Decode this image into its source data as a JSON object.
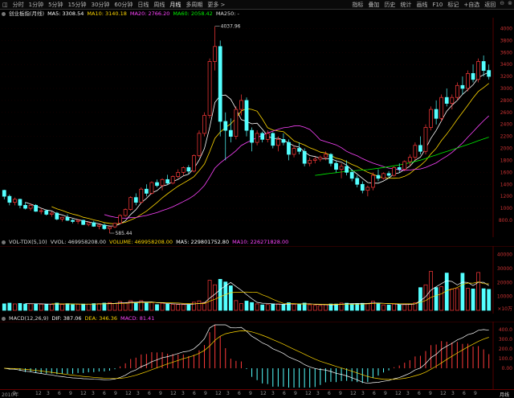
{
  "toolbar": {
    "left_icon": "◫",
    "tabs": [
      "分时",
      "1分钟",
      "5分钟",
      "15分钟",
      "30分钟",
      "60分钟",
      "日线",
      "周线",
      "月线",
      "多周期",
      "更多 >"
    ],
    "active_tab": "月线",
    "right_tabs": [
      "指标",
      "叠加",
      "历史",
      "统计",
      "画线",
      "F10",
      "标记",
      "+自选",
      "返回"
    ],
    "window_icons": [
      "minimize-icon",
      "close-icon"
    ]
  },
  "kline_legend": {
    "title": "创业板指(月线)",
    "ma5": "MA5: 3308.54",
    "ma10": "MA10: 3140.18",
    "ma20": "MA20: 2766.20",
    "ma60": "MA60: 2058.42",
    "ma250": "MA250: -"
  },
  "vol_legend": {
    "title": "VOL-TDX(5,10)",
    "vvol": "VVOL: 469958208.00",
    "volume": "VOLUME: 469958208.00",
    "ma5": "MA5: 229801752.80",
    "ma10": "MA10: 226271828.00"
  },
  "macd_legend": {
    "title": "MACD(12,26,9)",
    "dif": "DIF: 387.06",
    "dea": "DEA: 346.36",
    "macd": "MACD: 81.41"
  },
  "price_axis": [
    "4000",
    "3800",
    "3600",
    "3400",
    "3200",
    "3000",
    "2800",
    "2600",
    "2400",
    "2200",
    "2000",
    "1800",
    "1600",
    "1400",
    "1200",
    "1000",
    "800.0"
  ],
  "price_annotations": {
    "high": "4037.96",
    "low": "585.44"
  },
  "vol_axis": [
    "40000",
    "30000",
    "20000",
    "10000",
    "×10万"
  ],
  "macd_axis": [
    "400.0",
    "300.0",
    "200.0",
    "100.0",
    "0.00"
  ],
  "x_axis": [
    "2010年",
    "9",
    "",
    "12",
    "3",
    "6",
    "9",
    "12",
    "3",
    "6",
    "9",
    "12",
    "3",
    "6",
    "9",
    "12",
    "3",
    "6",
    "9",
    "12",
    "3",
    "6",
    "9",
    "12",
    "3",
    "6",
    "9",
    "12",
    "3",
    "6",
    "9",
    "12",
    "3",
    "6",
    "9",
    "12",
    "3",
    "6",
    "9",
    "12",
    "3",
    "6",
    "9",
    "月线"
  ],
  "colors": {
    "up": "#ff3a3a",
    "down": "#54ffff",
    "ma5": "#ffffff",
    "ma10": "#ffd700",
    "ma20": "#ff44ff",
    "ma60": "#00ee00",
    "grid": "#550000",
    "axis_text": "#cc3333"
  },
  "chart_data": {
    "type": "candlestick",
    "title": "创业板指(月线)",
    "price_ylim": [
      585,
      4100
    ],
    "candles": [
      [
        1300,
        1310,
        1150,
        1200
      ],
      [
        1200,
        1230,
        1050,
        1100
      ],
      [
        1100,
        1180,
        1050,
        1150
      ],
      [
        1150,
        1160,
        1000,
        1050
      ],
      [
        1050,
        1100,
        980,
        1000
      ],
      [
        1000,
        1080,
        960,
        1050
      ],
      [
        1050,
        1070,
        940,
        950
      ],
      [
        950,
        1000,
        900,
        960
      ],
      [
        960,
        980,
        880,
        900
      ],
      [
        900,
        950,
        860,
        920
      ],
      [
        920,
        940,
        800,
        820
      ],
      [
        820,
        860,
        780,
        850
      ],
      [
        850,
        900,
        790,
        800
      ],
      [
        800,
        820,
        750,
        780
      ],
      [
        780,
        820,
        740,
        800
      ],
      [
        800,
        810,
        720,
        730
      ],
      [
        730,
        780,
        700,
        760
      ],
      [
        760,
        790,
        690,
        700
      ],
      [
        700,
        740,
        650,
        720
      ],
      [
        720,
        750,
        640,
        660
      ],
      [
        660,
        700,
        585,
        690
      ],
      [
        690,
        760,
        670,
        750
      ],
      [
        750,
        900,
        740,
        880
      ],
      [
        880,
        1000,
        860,
        980
      ],
      [
        980,
        1200,
        960,
        1180
      ],
      [
        1180,
        1250,
        1050,
        1100
      ],
      [
        1100,
        1350,
        1080,
        1320
      ],
      [
        1320,
        1400,
        1200,
        1250
      ],
      [
        1250,
        1450,
        1230,
        1430
      ],
      [
        1430,
        1480,
        1350,
        1380
      ],
      [
        1380,
        1500,
        1300,
        1480
      ],
      [
        1480,
        1560,
        1400,
        1420
      ],
      [
        1420,
        1550,
        1400,
        1530
      ],
      [
        1530,
        1650,
        1500,
        1600
      ],
      [
        1600,
        1700,
        1550,
        1680
      ],
      [
        1680,
        1720,
        1580,
        1620
      ],
      [
        1620,
        1900,
        1600,
        1880
      ],
      [
        1880,
        2300,
        1850,
        2250
      ],
      [
        2250,
        2600,
        2200,
        2550
      ],
      [
        2550,
        3500,
        2500,
        3450
      ],
      [
        3450,
        4037,
        3300,
        3700
      ],
      [
        3700,
        3800,
        2200,
        2450
      ],
      [
        2450,
        2600,
        1800,
        2300
      ],
      [
        2300,
        2500,
        2100,
        2200
      ],
      [
        2200,
        2700,
        2150,
        2650
      ],
      [
        2650,
        2900,
        2550,
        2800
      ],
      [
        2800,
        2850,
        2200,
        2300
      ],
      [
        2300,
        2350,
        1950,
        2100
      ],
      [
        2100,
        2300,
        2050,
        2250
      ],
      [
        2250,
        2280,
        2100,
        2150
      ],
      [
        2150,
        2300,
        2100,
        2250
      ],
      [
        2250,
        2270,
        2000,
        2050
      ],
      [
        2050,
        2200,
        1950,
        2150
      ],
      [
        2150,
        2250,
        2050,
        2100
      ],
      [
        2100,
        2150,
        1800,
        1900
      ],
      [
        1900,
        2050,
        1850,
        2000
      ],
      [
        2000,
        2100,
        1900,
        1950
      ],
      [
        1950,
        2000,
        1700,
        1750
      ],
      [
        1750,
        1850,
        1700,
        1800
      ],
      [
        1800,
        1860,
        1750,
        1820
      ],
      [
        1820,
        1880,
        1780,
        1850
      ],
      [
        1850,
        1950,
        1800,
        1900
      ],
      [
        1900,
        1920,
        1700,
        1750
      ],
      [
        1750,
        1800,
        1600,
        1650
      ],
      [
        1650,
        1750,
        1500,
        1700
      ],
      [
        1700,
        1800,
        1550,
        1600
      ],
      [
        1600,
        1650,
        1450,
        1500
      ],
      [
        1500,
        1550,
        1350,
        1400
      ],
      [
        1400,
        1450,
        1250,
        1300
      ],
      [
        1300,
        1380,
        1200,
        1350
      ],
      [
        1350,
        1600,
        1300,
        1550
      ],
      [
        1550,
        1650,
        1450,
        1500
      ],
      [
        1500,
        1600,
        1480,
        1580
      ],
      [
        1580,
        1620,
        1500,
        1550
      ],
      [
        1550,
        1700,
        1530,
        1680
      ],
      [
        1680,
        1750,
        1600,
        1650
      ],
      [
        1650,
        1800,
        1620,
        1780
      ],
      [
        1780,
        1900,
        1700,
        1850
      ],
      [
        1850,
        2100,
        1800,
        2050
      ],
      [
        2050,
        2200,
        1900,
        1950
      ],
      [
        1950,
        2400,
        1900,
        2350
      ],
      [
        2350,
        2700,
        2300,
        2650
      ],
      [
        2650,
        2800,
        2400,
        2500
      ],
      [
        2500,
        2900,
        2450,
        2850
      ],
      [
        2850,
        3000,
        2700,
        2750
      ],
      [
        2750,
        2900,
        2650,
        2850
      ],
      [
        2850,
        3100,
        2800,
        3050
      ],
      [
        3050,
        3200,
        2900,
        3000
      ],
      [
        3000,
        3300,
        2950,
        3250
      ],
      [
        3250,
        3400,
        3100,
        3150
      ],
      [
        3150,
        3500,
        3100,
        3450
      ],
      [
        3450,
        3550,
        3200,
        3300
      ],
      [
        3300,
        3400,
        3150,
        3200
      ]
    ],
    "ma_labels": [
      "MA5",
      "MA10",
      "MA20",
      "MA60"
    ],
    "volume_ylim": [
      0,
      45000
    ],
    "macd_ylim": [
      -200,
      450
    ],
    "macd_dif": 387.06,
    "macd_dea": 346.36,
    "macd_hist": 81.41
  }
}
